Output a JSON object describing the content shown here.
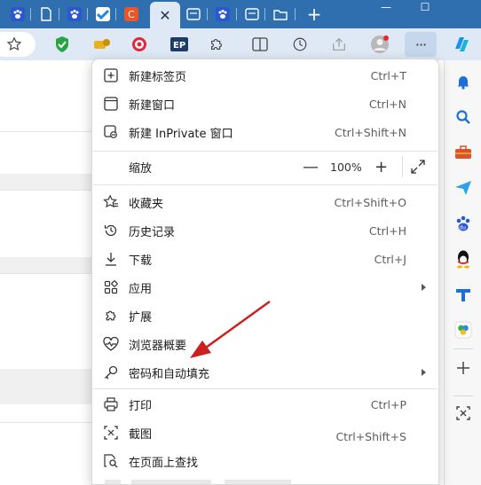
{
  "tabs": [
    {
      "name": "baidu-tab-1",
      "icon": "baidu-paw-icon"
    },
    {
      "name": "blank-tab",
      "icon": "document-icon"
    },
    {
      "name": "baidu-tab-2",
      "icon": "baidu-paw-icon"
    },
    {
      "name": "blue-check-tab",
      "icon": "check-app-icon"
    },
    {
      "name": "orange-c-tab",
      "icon": "c-app-icon",
      "glyph": "C"
    },
    {
      "name": "active-tab",
      "icon": "close-icon",
      "glyph": "✕"
    },
    {
      "name": "tab-overview-1",
      "icon": "window-icon"
    },
    {
      "name": "baidu-tab-3",
      "icon": "baidu-paw-icon"
    },
    {
      "name": "tab-overview-2",
      "icon": "window-icon"
    },
    {
      "name": "folder-tab",
      "icon": "folder-icon"
    }
  ],
  "window": {
    "new_tab": "+",
    "minimize": "—",
    "maximize": "☐"
  },
  "toolbar": {
    "more_label": "···"
  },
  "menu": {
    "new_tab": {
      "label": "新建标签页",
      "shortcut": "Ctrl+T"
    },
    "new_window": {
      "label": "新建窗口",
      "shortcut": "Ctrl+N"
    },
    "new_inprivate": {
      "label": "新建 InPrivate 窗口",
      "shortcut": "Ctrl+Shift+N"
    },
    "zoom": {
      "label": "缩放",
      "minus": "—",
      "value": "100%",
      "plus": "+"
    },
    "favorites": {
      "label": "收藏夹",
      "shortcut": "Ctrl+Shift+O"
    },
    "history": {
      "label": "历史记录",
      "shortcut": "Ctrl+H"
    },
    "downloads": {
      "label": "下载",
      "shortcut": "Ctrl+J"
    },
    "apps": {
      "label": "应用"
    },
    "extensions": {
      "label": "扩展"
    },
    "browser_essentials": {
      "label": "浏览器概要"
    },
    "passwords_autofill": {
      "label": "密码和自动填充"
    },
    "print": {
      "label": "打印",
      "shortcut": "Ctrl+P"
    },
    "screenshot": {
      "label": "截图",
      "shortcut": "Ctrl+Shift+S"
    },
    "find_on_page": {
      "label": "在页面上查找"
    }
  },
  "colors": {
    "tabstrip": "#2f6fb0",
    "toolbar": "#dfe9f5",
    "annotation_arrow": "#cc1f1f"
  }
}
